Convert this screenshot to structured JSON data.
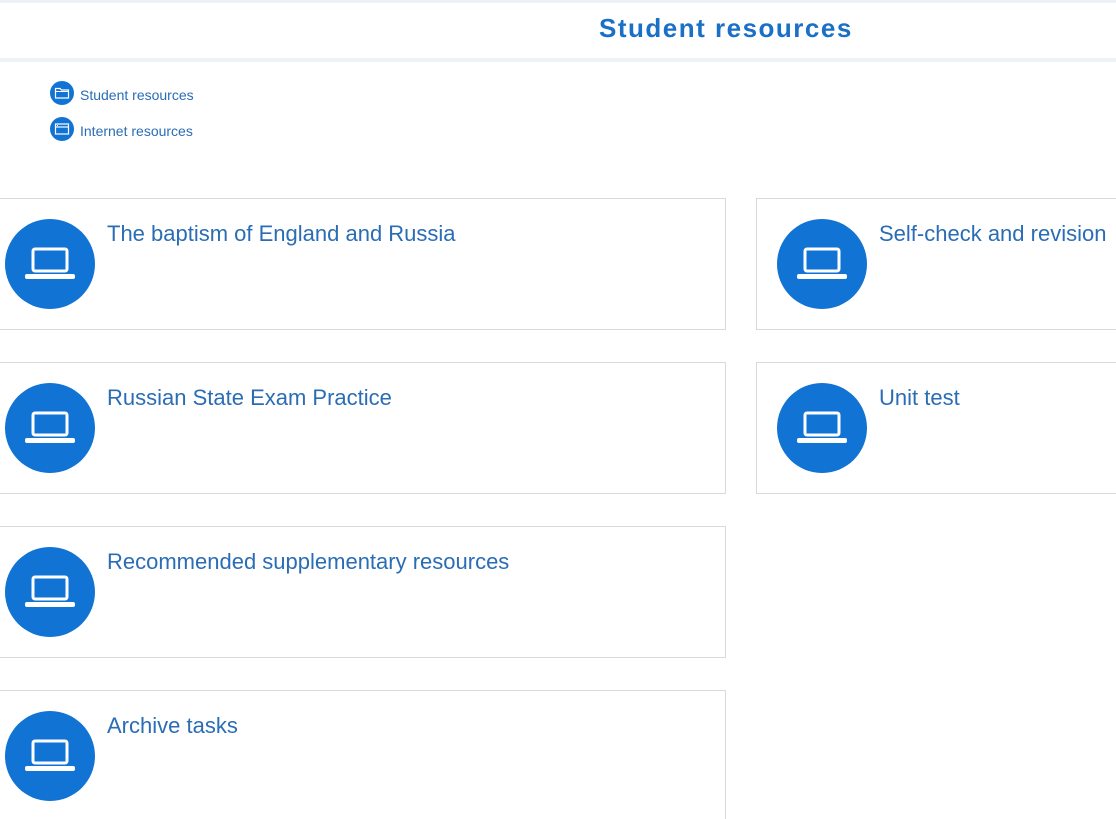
{
  "header": {
    "title": "Student resources"
  },
  "nav": {
    "items": [
      {
        "label": "Student resources",
        "icon": "folder-icon"
      },
      {
        "label": "Internet resources",
        "icon": "browser-window-icon"
      }
    ]
  },
  "cards": [
    {
      "title": "The baptism of England and Russia",
      "icon": "laptop-icon"
    },
    {
      "title": "Self-check and revision",
      "icon": "laptop-icon"
    },
    {
      "title": "Russian State Exam Practice",
      "icon": "laptop-icon"
    },
    {
      "title": "Unit test",
      "icon": "laptop-icon"
    },
    {
      "title": "Recommended supplementary resources",
      "icon": "laptop-icon"
    },
    {
      "title": "Archive tasks",
      "icon": "laptop-icon"
    }
  ],
  "colors": {
    "accent": "#1173d4",
    "link_text": "#2a6db5",
    "title_text": "#1a6fc7",
    "card_border": "#d9d9d9",
    "header_border": "#eef2f6"
  }
}
